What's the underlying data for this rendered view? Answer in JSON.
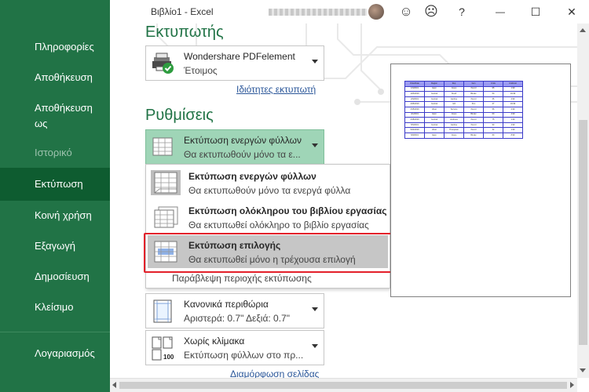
{
  "window": {
    "title": "Βιβλίο1  -  Excel",
    "controls": {
      "help": "?",
      "minimize": "—",
      "restore": "☐",
      "close": "✕",
      "smile": "☺",
      "frown": "☹"
    }
  },
  "sidebar": {
    "items": [
      {
        "label": "Πληροφορίες"
      },
      {
        "label": "Αποθήκευση"
      },
      {
        "label": "Αποθήκευση"
      },
      {
        "label": "ως"
      },
      {
        "label": "Ιστορικό"
      },
      {
        "label": "Εκτύπωση"
      },
      {
        "label": "Κοινή χρήση"
      },
      {
        "label": "Εξαγωγή"
      },
      {
        "label": "Δημοσίευση"
      },
      {
        "label": "Κλείσιμο"
      },
      {
        "label": "Λογαριασμός"
      }
    ]
  },
  "printer": {
    "heading": "Εκτυπωτής",
    "name": "Wondershare PDFelement",
    "status": "Έτοιμος",
    "properties_link": "Ιδιότητες εκτυπωτή"
  },
  "settings": {
    "heading": "Ρυθμίσεις",
    "selected_title": "Εκτύπωση ενεργών φύλλων",
    "selected_desc": "Θα εκτυπωθούν μόνο τα ε...",
    "menu": [
      {
        "title": "Εκτύπωση ενεργών φύλλων",
        "desc": "Θα εκτυπωθούν μόνο τα ενεργά φύλλα"
      },
      {
        "title": "Εκτύπωση ολόκληρου του βιβλίου εργασίας",
        "desc": "Θα εκτυπωθεί ολόκληρο το βιβλίο εργασίας"
      },
      {
        "title": "Εκτύπωση επιλογής",
        "desc": "Θα εκτυπωθεί μόνο η τρέχουσα επιλογή"
      }
    ],
    "ignore_print_area": "Παράβλεψη περιοχής εκτύπωσης",
    "margins_title": "Κανονικά περιθώρια",
    "margins_desc": "Αριστερά: 0.7\"   Δεξιά: 0.7\"",
    "scaling_title": "Χωρίς κλίμακα",
    "scaling_desc": "Εκτύπωση φύλλων στο πρ...",
    "scaling_icon_label": "100",
    "page_setup_link": "Διαμόρφωση σελίδας"
  },
  "colors": {
    "accent": "#217346",
    "sidebar_active": "#0e5c30",
    "highlight_box": "#e3202a",
    "preview_header": "#9b9bf2",
    "preview_border": "#3a3ac8"
  },
  "preview": {
    "header": [
      "OrderDate",
      "Region",
      "Rep",
      "Item",
      "Units",
      "UnitCost"
    ],
    "rows": [
      [
        "1/6/2019",
        "East",
        "Jones",
        "Pencil",
        "95",
        "1.99"
      ],
      [
        "1/23/2019",
        "Central",
        "Kivell",
        "Binder",
        "50",
        "19.99"
      ],
      [
        "2/9/2019",
        "Central",
        "Jardine",
        "Pencil",
        "36",
        "4.99"
      ],
      [
        "2/26/2019",
        "Central",
        "Gill",
        "Pen",
        "27",
        "19.99"
      ],
      [
        "3/15/2019",
        "West",
        "Sorvino",
        "Pencil",
        "56",
        "2.99"
      ],
      [
        "4/1/2019",
        "East",
        "Jones",
        "Binder",
        "60",
        "4.99"
      ],
      [
        "4/18/2019",
        "Central",
        "Andrews",
        "Pencil",
        "75",
        "1.99"
      ],
      [
        "5/5/2019",
        "Central",
        "Jardine",
        "Pencil",
        "90",
        "4.99"
      ],
      [
        "5/22/2019",
        "West",
        "Thompson",
        "Pencil",
        "32",
        "1.99"
      ],
      [
        "6/8/2019",
        "East",
        "Jones",
        "Binder",
        "60",
        "8.99"
      ]
    ]
  }
}
